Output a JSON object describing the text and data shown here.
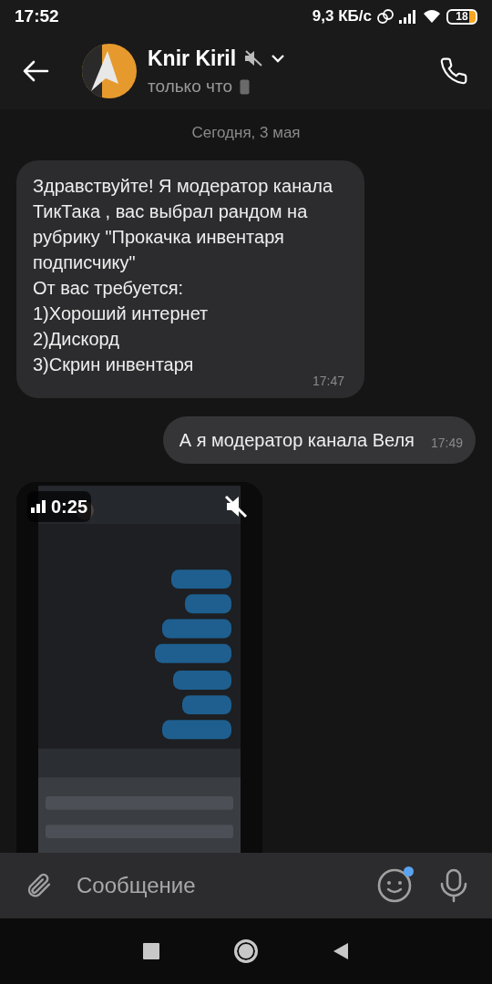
{
  "status_bar": {
    "time": "17:52",
    "network_speed": "9,3 КБ/с",
    "battery": "18"
  },
  "header": {
    "name": "Knir Kiril",
    "muted": true,
    "status": "только что"
  },
  "date_separator": "Сегодня, 3 мая",
  "messages": [
    {
      "kind": "text",
      "outgoing": false,
      "text": "Здравствуйте! Я модератор канала ТикТака , вас выбрал рандом на рубрику \"Прокачка инвентаря подписчику\"\nОт вас требуется:\n1)Хороший интернет\n2)Дискорд\n3)Скрин инвентаря",
      "time": "17:47"
    },
    {
      "kind": "text",
      "outgoing": true,
      "text": "А я модератор канала Веля",
      "time": "17:49"
    },
    {
      "kind": "video",
      "outgoing": false,
      "duration": "0:25",
      "muted": true
    }
  ],
  "composer": {
    "placeholder": "Сообщение",
    "emoji_unread": true
  }
}
